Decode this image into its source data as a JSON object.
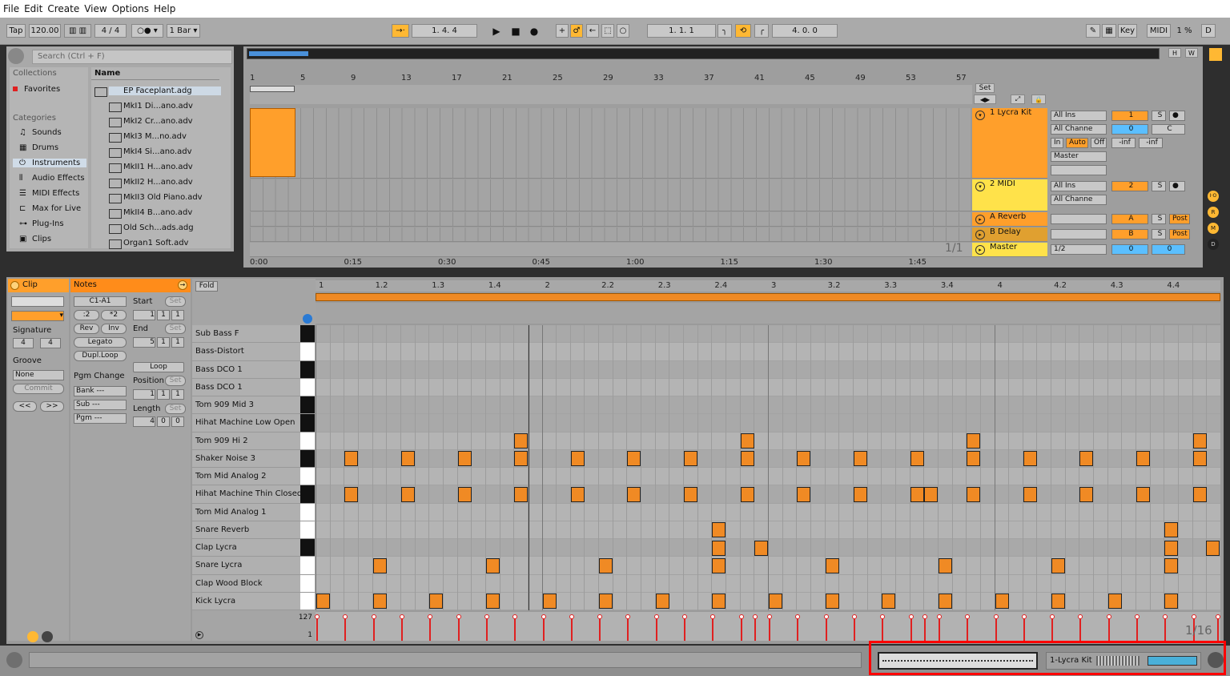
{
  "menu": [
    "File",
    "Edit",
    "Create",
    "View",
    "Options",
    "Help"
  ],
  "transport": {
    "tap": "Tap",
    "tempo": "120.00",
    "sig_num": "4",
    "sig_den": "4",
    "quant": "1 Bar",
    "pos": "1.   4.   4",
    "pos2": "1.   1.   1",
    "loop_len": "4.   0.   0",
    "key": "Key",
    "midi": "MIDI",
    "cpu": "1 %",
    "d": "D"
  },
  "browser": {
    "search_placeholder": "Search (Ctrl + F)",
    "collections_label": "Collections",
    "favorites": "Favorites",
    "categories_label": "Categories",
    "categories": [
      "Sounds",
      "Drums",
      "Instruments",
      "Audio Effects",
      "MIDI Effects",
      "Max for Live",
      "Plug-Ins",
      "Clips"
    ],
    "name_header": "Name",
    "files": [
      "EP Faceplant.adg",
      "MkI1 Di...ano.adv",
      "MkI2 Cr...ano.adv",
      "MkI3 M...no.adv",
      "MkI4 Si...ano.adv",
      "MkII1 H...ano.adv",
      "MkII2 H...ano.adv",
      "MkII3 Old Piano.adv",
      "MkII4 B...ano.adv",
      "Old Sch...ads.adg",
      "Organ1 Soft.adv"
    ]
  },
  "arrangement": {
    "bars": [
      "1",
      "5",
      "9",
      "13",
      "17",
      "21",
      "25",
      "29",
      "33",
      "37",
      "41",
      "45",
      "49",
      "53",
      "57"
    ],
    "times": [
      "0:00",
      "0:15",
      "0:30",
      "0:45",
      "1:00",
      "1:15",
      "1:30",
      "1:45"
    ],
    "set": "Set",
    "hw": "H",
    "ww": "W",
    "pagination": "1/1",
    "tracks": [
      {
        "name": "1 Lycra Kit",
        "input": "All Ins",
        "channel": "All Channe",
        "monitor": [
          "In",
          "Auto",
          "Off"
        ],
        "output": "Master",
        "num": "1",
        "s": "S",
        "vol": "0",
        "pan": "C",
        "inf1": "-inf",
        "inf2": "-inf"
      },
      {
        "name": "2 MIDI",
        "input": "All Ins",
        "channel": "All Channe",
        "num": "2",
        "s": "S"
      },
      {
        "name": "A Reverb",
        "num": "A",
        "s": "S",
        "post": "Post"
      },
      {
        "name": "B Delay",
        "num": "B",
        "s": "S",
        "post": "Post"
      },
      {
        "name": "Master",
        "output": "1/2",
        "vol": "0",
        "pan": "0"
      }
    ]
  },
  "clip": {
    "title": "Clip",
    "signature_label": "Signature",
    "sig_num": "4",
    "sig_den": "4",
    "groove_label": "Groove",
    "groove_val": "None",
    "commit": "Commit",
    "nav_prev": "<<",
    "nav_next": ">>"
  },
  "notes": {
    "title": "Notes",
    "range": "C1-A1",
    "half": ":2",
    "double": "*2",
    "rev": "Rev",
    "inv": "Inv",
    "legato": "Legato",
    "dupl": "Dupl.Loop",
    "start": "Start",
    "end": "End",
    "loop": "Loop",
    "position": "Position",
    "length": "Length",
    "set": "Set",
    "pgm_change": "Pgm Change",
    "bank": "Bank ---",
    "sub": "Sub ---",
    "pgm": "Pgm ---",
    "start_vals": [
      "1",
      "1",
      "1"
    ],
    "end_vals": [
      "5",
      "1",
      "1"
    ],
    "pos_vals": [
      "1",
      "1",
      "1"
    ],
    "len_vals": [
      "4",
      "0",
      "0"
    ]
  },
  "piano": {
    "fold": "Fold",
    "ruler": [
      "1",
      "1.2",
      "1.3",
      "1.4",
      "2",
      "2.2",
      "2.3",
      "2.4",
      "3",
      "3.2",
      "3.3",
      "3.4",
      "4",
      "4.2",
      "4.3",
      "4.4"
    ],
    "vel_max": "127",
    "vel_min": "1",
    "grid_label": "1/16",
    "rows": [
      "Sub Bass F",
      "Bass-Distort",
      "Bass DCO 1",
      "Bass DCO 1",
      "Tom 909 Mid 3",
      "Hihat Machine Low Open",
      "Tom 909 Hi 2",
      "Shaker Noise 3",
      "Tom Mid Analog 2",
      "Hihat Machine Thin Closed",
      "Tom Mid Analog 1",
      "Snare Reverb",
      "Clap Lycra",
      "Snare Lycra",
      "Clap Wood Block",
      "Kick Lycra"
    ]
  },
  "status": {
    "track_name": "1-Lycra Kit"
  },
  "colors": {
    "accent": "#ff8c1a",
    "clip": "#ff9f2b",
    "midi_track": "#ffe24a",
    "highlight": "#ff0000"
  }
}
